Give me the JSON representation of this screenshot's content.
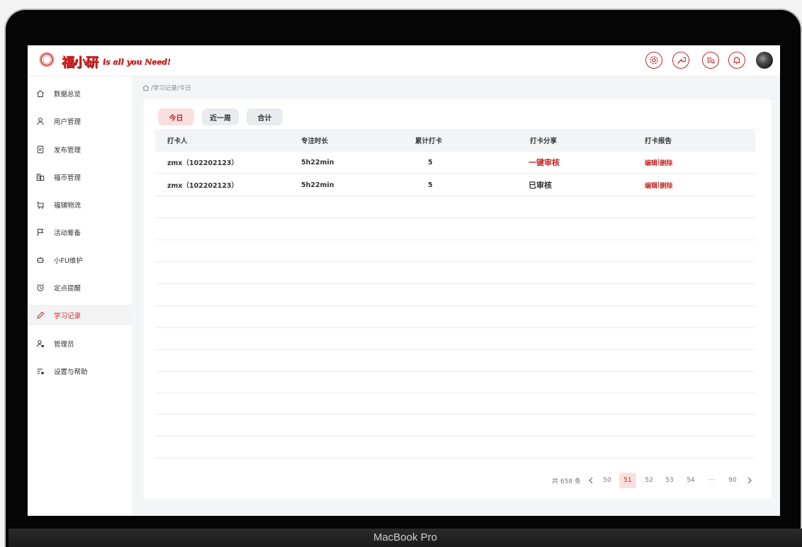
{
  "header": {
    "logo_title": "福小研",
    "logo_slogan": "is all you Need!",
    "icons": [
      "settings-icon",
      "wrench-icon",
      "search-list-icon",
      "bell-icon"
    ]
  },
  "sidebar": {
    "items": [
      {
        "label": "数据总览",
        "icon": "home-icon"
      },
      {
        "label": "用户管理",
        "icon": "user-icon"
      },
      {
        "label": "发布管理",
        "icon": "document-icon"
      },
      {
        "label": "福币管理",
        "icon": "coins-icon"
      },
      {
        "label": "福铺物流",
        "icon": "cart-icon"
      },
      {
        "label": "活动筹备",
        "icon": "flag-icon"
      },
      {
        "label": "小FU维护",
        "icon": "robot-icon"
      },
      {
        "label": "定点提醒",
        "icon": "alarm-icon"
      },
      {
        "label": "学习记录",
        "icon": "pencil-icon",
        "active": true
      },
      {
        "label": "管理员",
        "icon": "admin-icon"
      },
      {
        "label": "设置与帮助",
        "icon": "settings-help-icon"
      }
    ]
  },
  "breadcrumb": "/学习记录/今日",
  "tabs": [
    {
      "label": "今日",
      "active": true
    },
    {
      "label": "近一周",
      "active": false
    },
    {
      "label": "合计",
      "active": false
    }
  ],
  "table": {
    "headers": [
      "打卡人",
      "专注时长",
      "累计打卡",
      "打卡分享",
      "打卡报告"
    ],
    "rows": [
      {
        "name": "zmx（102202123）",
        "duration": "5h22min",
        "count": "5",
        "share": "一键审核",
        "share_status": "pending",
        "edit": "编辑",
        "sep": "|",
        "delete": "删除"
      },
      {
        "name": "zmx（102202123）",
        "duration": "5h22min",
        "count": "5",
        "share": "已审核",
        "share_status": "done",
        "edit": "编辑",
        "sep": "|",
        "delete": "删除"
      }
    ]
  },
  "pagination": {
    "total": "共 658 条",
    "pages": [
      "50",
      "51",
      "52",
      "53",
      "54",
      "···",
      "90"
    ],
    "current": "51"
  },
  "device_label": "MacBook Pro",
  "colors": {
    "accent": "#c62828",
    "accent_light": "#f9e0df",
    "tab_bg": "#e9ebef"
  }
}
